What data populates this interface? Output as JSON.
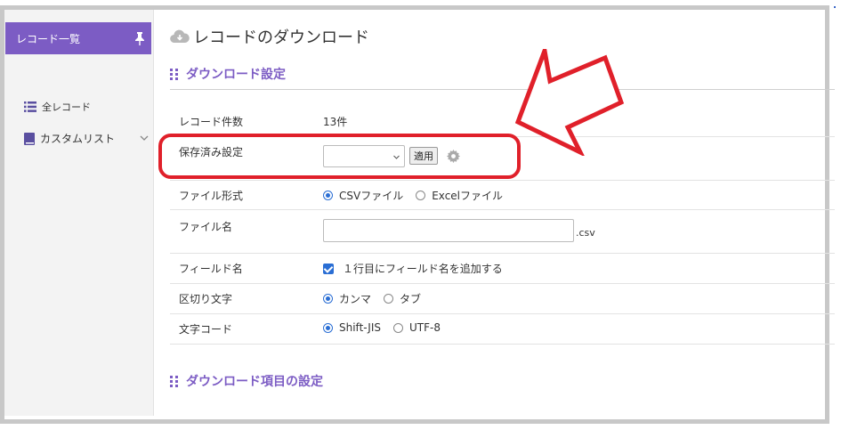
{
  "sidebar": {
    "active_item": "レコード一覧",
    "items": [
      {
        "label": "全レコード",
        "icon": "list-icon"
      },
      {
        "label": "カスタムリスト",
        "icon": "book-icon"
      }
    ]
  },
  "page": {
    "title": "レコードのダウンロード",
    "title_icon": "cloud-download-icon"
  },
  "section1": {
    "title": "ダウンロード設定"
  },
  "form": {
    "record_count": {
      "label": "レコード件数",
      "value": "13件"
    },
    "saved_settings": {
      "label": "保存済み設定",
      "select_value": "",
      "apply_label": "適用"
    },
    "file_format": {
      "label": "ファイル形式",
      "options": [
        "CSVファイル",
        "Excelファイル"
      ],
      "selected": "CSVファイル"
    },
    "file_name": {
      "label": "ファイル名",
      "value": "",
      "suffix": ".csv"
    },
    "field_name": {
      "label": "フィールド名",
      "checkbox_label": "１行目にフィールド名を追加する",
      "checked": true
    },
    "delimiter": {
      "label": "区切り文字",
      "options": [
        "カンマ",
        "タブ"
      ],
      "selected": "カンマ"
    },
    "encoding": {
      "label": "文字コード",
      "options": [
        "Shift-JIS",
        "UTF-8"
      ],
      "selected": "Shift-JIS"
    }
  },
  "section2": {
    "title": "ダウンロード項目の設定"
  },
  "annotation": {
    "highlight_color": "#e0202a",
    "arrow_color": "#e0202a"
  },
  "colors": {
    "accent": "#7c5cc4",
    "control_blue": "#2a6ed4"
  }
}
